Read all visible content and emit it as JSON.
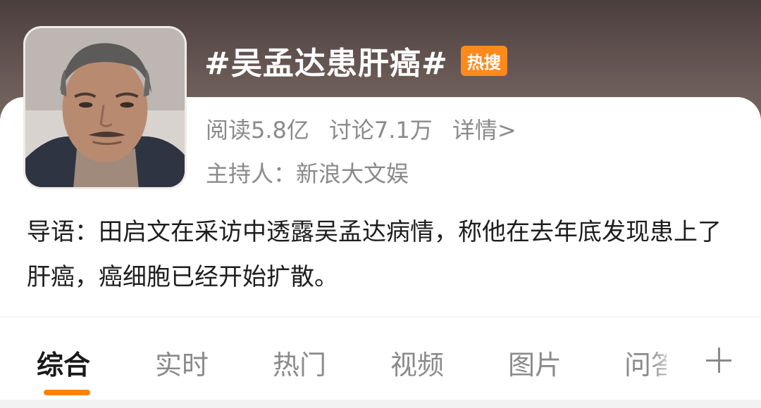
{
  "topic": {
    "title": "#吴孟达患肝癌#",
    "badge": "热搜",
    "reads": "阅读5.8亿",
    "discussions": "讨论7.1万",
    "detail_link": "详情>",
    "host_label": "主持人：",
    "host_name": "新浪大文娱"
  },
  "intro": {
    "text": "导语：田启文在采访中透露吴孟达病情，称他在去年底发现患上了肝癌，癌细胞已经开始扩散。"
  },
  "tabs": [
    {
      "label": "综合",
      "active": true
    },
    {
      "label": "实时",
      "active": false
    },
    {
      "label": "热门",
      "active": false
    },
    {
      "label": "视频",
      "active": false
    },
    {
      "label": "图片",
      "active": false
    },
    {
      "label": "问答",
      "active": false
    }
  ],
  "colors": {
    "badge": "#ff8a1c",
    "active_indicator": "#ff8200",
    "muted_text": "#8a8a8a"
  },
  "icons": {
    "avatar": "portrait-photo",
    "add_tab": "plus-icon"
  }
}
